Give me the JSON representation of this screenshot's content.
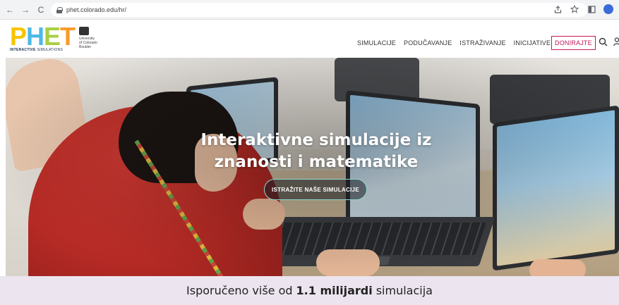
{
  "browser": {
    "url": "phet.colorado.edu/hr/",
    "back_icon": "←",
    "forward_icon": "→",
    "reload_icon": "C"
  },
  "header": {
    "logo": {
      "letters": [
        "P",
        "H",
        "E",
        "T"
      ],
      "tagline_bold": "INTERACTIVE",
      "tagline": " SIMULATIONS"
    },
    "university": {
      "line1": "University",
      "line2": "of Colorado",
      "line3": "Boulder"
    },
    "nav": [
      {
        "label": "SIMULACIJE"
      },
      {
        "label": "PODUČAVANJE"
      },
      {
        "label": "ISTRAŽIVANJE"
      },
      {
        "label": "INICIJATIVE"
      }
    ],
    "donate_label": "DONIRAJTE"
  },
  "hero": {
    "title_line1": "Interaktivne simulacije iz",
    "title_line2": "znanosti i matematike",
    "cta_label": "ISTRAŽITE NAŠE SIMULACIJE"
  },
  "stats": {
    "prefix": "Isporučeno više od",
    "highlight": "1.1 milijardi",
    "suffix": "simulacija"
  },
  "colors": {
    "donate": "#c2185b",
    "cta_border": "#8fd6cc",
    "stats_bg": "#ece5ef",
    "logo_p": "#f7c400",
    "logo_h": "#4cb9e8",
    "logo_e": "#a8cf45",
    "logo_t": "#f89b29"
  }
}
